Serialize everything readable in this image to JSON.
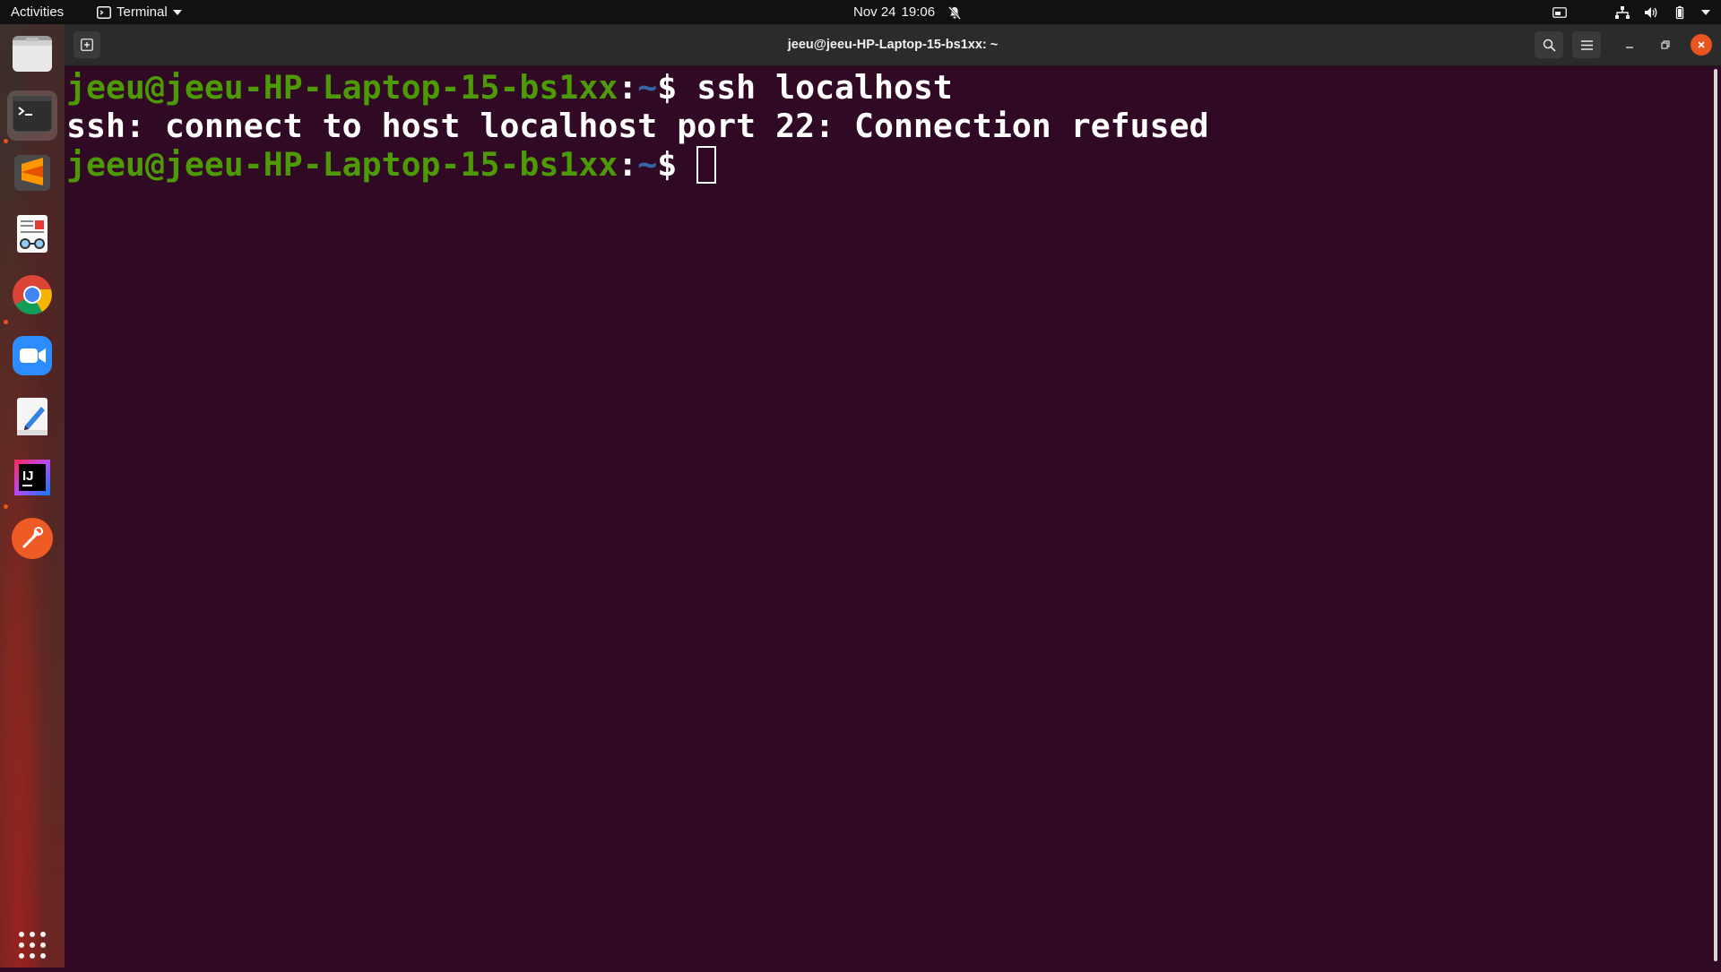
{
  "topbar": {
    "activities": "Activities",
    "app_name": "Terminal",
    "date": "Nov 24",
    "time": "19:06"
  },
  "dock": {
    "items": [
      {
        "name": "Files",
        "icon": "files-icon"
      },
      {
        "name": "Terminal",
        "icon": "terminal-icon"
      },
      {
        "name": "Sublime Text",
        "icon": "sublime-text-icon"
      },
      {
        "name": "Document Viewer",
        "icon": "document-viewer-icon"
      },
      {
        "name": "Google Chrome",
        "icon": "chrome-icon"
      },
      {
        "name": "Zoom",
        "icon": "zoom-icon"
      },
      {
        "name": "Text Editor",
        "icon": "text-editor-icon"
      },
      {
        "name": "IntelliJ IDEA",
        "icon": "intellij-icon"
      },
      {
        "name": "Postman",
        "icon": "postman-icon"
      }
    ],
    "show_apps_icon": "app-grid-icon"
  },
  "window": {
    "title": "jeeu@jeeu-HP-Laptop-15-bs1xx: ~"
  },
  "terminal": {
    "lines": [
      {
        "user": "jeeu@jeeu-HP-Laptop-15-bs1xx",
        "colon": ":",
        "path": "~",
        "dollar": "$ ",
        "command": "ssh localhost"
      },
      {
        "output": "ssh: connect to host localhost port 22: Connection refused"
      },
      {
        "user": "jeeu@jeeu-HP-Laptop-15-bs1xx",
        "colon": ":",
        "path": "~",
        "dollar": "$ ",
        "command": ""
      }
    ]
  },
  "colors": {
    "terminal_bg": "#300a24",
    "prompt_user": "#4e9a06",
    "prompt_path": "#3465a4",
    "accent": "#e95420"
  }
}
